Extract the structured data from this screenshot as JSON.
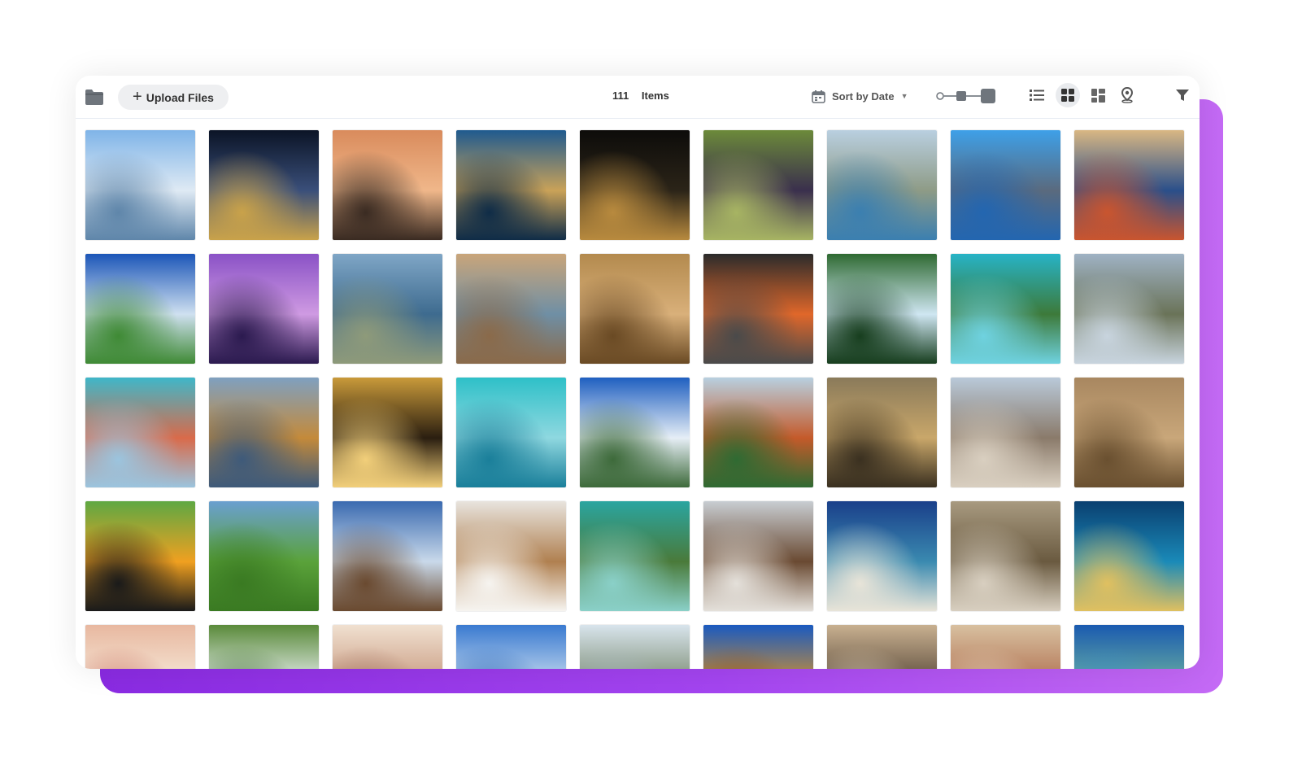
{
  "toolbar": {
    "folder_icon": "folder-icon",
    "upload_label": "Upload Files",
    "item_count": "111",
    "items_label": "Items",
    "sort_label": "Sort by Date",
    "view_modes": [
      "list-view-icon",
      "grid-view-icon",
      "mosaic-view-icon",
      "map-view-icon"
    ],
    "active_view": "grid-view-icon",
    "filter_icon": "filter-icon"
  },
  "colors": {
    "accent": "#a445f0",
    "accent_dark": "#8a2be2",
    "toolbar_button_bg": "#eeeff1",
    "text": "#333333"
  },
  "tiles": [
    {
      "subject": "glacier",
      "colors": [
        "#7fb4e8",
        "#dfeaf4",
        "#5f86aa"
      ]
    },
    {
      "subject": "city-lights-night",
      "colors": [
        "#0b1426",
        "#3a4f7a",
        "#c9a24a"
      ]
    },
    {
      "subject": "elephant-sunset",
      "colors": [
        "#d98b5c",
        "#f0b78a",
        "#3a2b22"
      ]
    },
    {
      "subject": "temple-reflection",
      "colors": [
        "#1f5a8f",
        "#caa258",
        "#0f2c47"
      ]
    },
    {
      "subject": "skyline-night",
      "colors": [
        "#0d0c0a",
        "#2b2418",
        "#b88a3e"
      ]
    },
    {
      "subject": "vineyard-grapes",
      "colors": [
        "#6c8a3a",
        "#3a2f4d",
        "#a7b463"
      ]
    },
    {
      "subject": "coastal-city",
      "colors": [
        "#b9cfe0",
        "#8e9b86",
        "#3b7fb0"
      ]
    },
    {
      "subject": "river-bridge",
      "colors": [
        "#3ea0e8",
        "#5a6a7e",
        "#2366b0"
      ]
    },
    {
      "subject": "rice-dish",
      "colors": [
        "#d9b783",
        "#2a4f8a",
        "#c9552f"
      ]
    },
    {
      "subject": "blue-cathedral",
      "colors": [
        "#1c56b8",
        "#cfe0f0",
        "#3f8a35"
      ]
    },
    {
      "subject": "pagoda-purple-sky",
      "colors": [
        "#8a52c6",
        "#cf9ae2",
        "#2b1a4f"
      ]
    },
    {
      "subject": "mountain-lake",
      "colors": [
        "#7fa6c6",
        "#3e6b8f",
        "#8e9a7a"
      ]
    },
    {
      "subject": "rock-arch-coast",
      "colors": [
        "#c9a57a",
        "#6f8fa5",
        "#8a6a4a"
      ]
    },
    {
      "subject": "lion",
      "colors": [
        "#b38a4e",
        "#d9b07a",
        "#6a4a24"
      ]
    },
    {
      "subject": "lava-flow",
      "colors": [
        "#2b2b2b",
        "#e0672a",
        "#4a4a4a"
      ]
    },
    {
      "subject": "waterfall",
      "colors": [
        "#2f6a32",
        "#cfe6f2",
        "#173e1e"
      ]
    },
    {
      "subject": "turquoise-bay",
      "colors": [
        "#27b3c6",
        "#3d7a3a",
        "#6fd2e0"
      ]
    },
    {
      "subject": "great-wall",
      "colors": [
        "#9fb2c4",
        "#6a7358",
        "#c8d4de"
      ]
    },
    {
      "subject": "colorful-harbor",
      "colors": [
        "#3fb7c9",
        "#d96a4a",
        "#9bc4de"
      ]
    },
    {
      "subject": "cliff-lake",
      "colors": [
        "#7fa0c0",
        "#c48a3a",
        "#3e5a7a"
      ]
    },
    {
      "subject": "surfer-sunset",
      "colors": [
        "#c99a3a",
        "#2a1e10",
        "#f2cf7a"
      ]
    },
    {
      "subject": "snorkeler",
      "colors": [
        "#2ec0c8",
        "#8fd8e0",
        "#1a7f9a"
      ]
    },
    {
      "subject": "iguazu-falls",
      "colors": [
        "#1f5fc0",
        "#e6eef6",
        "#3d6a3a"
      ]
    },
    {
      "subject": "pavilion-garden",
      "colors": [
        "#b8d0e0",
        "#c45a2a",
        "#2f6a32"
      ]
    },
    {
      "subject": "jaguars",
      "colors": [
        "#8a7a5a",
        "#c9a76a",
        "#3a3020"
      ]
    },
    {
      "subject": "paris-rooftops",
      "colors": [
        "#b9c9d9",
        "#8a7a6a",
        "#d9cfc0"
      ]
    },
    {
      "subject": "terracotta-warriors",
      "colors": [
        "#a88760",
        "#c9a77a",
        "#6a5030"
      ]
    },
    {
      "subject": "toucan",
      "colors": [
        "#5ea843",
        "#f0a020",
        "#1a1a1a"
      ]
    },
    {
      "subject": "green-field",
      "colors": [
        "#6a9fd0",
        "#5aa23a",
        "#3a7a22"
      ]
    },
    {
      "subject": "baobab-tree",
      "colors": [
        "#3a6ab0",
        "#c9d9ea",
        "#6a4a30"
      ]
    },
    {
      "subject": "cafe-chairs",
      "colors": [
        "#e8e4de",
        "#b08050",
        "#f6f4f0"
      ]
    },
    {
      "subject": "yacht-bay",
      "colors": [
        "#2aa5a0",
        "#4a7a3a",
        "#8ad0c8"
      ]
    },
    {
      "subject": "half-timbered-houses",
      "colors": [
        "#c8cdd2",
        "#6a4a32",
        "#e4e0da"
      ]
    },
    {
      "subject": "table-mountain-beach",
      "colors": [
        "#1a3f8a",
        "#3a8ab0",
        "#e8e4d8"
      ]
    },
    {
      "subject": "forest-boardwalk",
      "colors": [
        "#a89a80",
        "#6a5a40",
        "#d8cfc0"
      ]
    },
    {
      "subject": "city-night-reflection",
      "colors": [
        "#0a3f70",
        "#1a8ab8",
        "#e0c060"
      ]
    },
    {
      "subject": "turkish-delight",
      "colors": [
        "#e8b8a0",
        "#f6e8d8",
        "#c86a5a"
      ]
    },
    {
      "subject": "green-waterfall",
      "colors": [
        "#5a8a3a",
        "#e8f0f0",
        "#3a6a2a"
      ]
    },
    {
      "subject": "mosque-dome",
      "colors": [
        "#f0e0d0",
        "#c89a80",
        "#a07060"
      ]
    },
    {
      "subject": "blue-sea-horizon",
      "colors": [
        "#3a7ad0",
        "#c8dcf0",
        "#1a5ab0"
      ]
    },
    {
      "subject": "misty-mountains",
      "colors": [
        "#d8e4ec",
        "#7a8a70",
        "#a8b8c0"
      ]
    },
    {
      "subject": "golden-dome",
      "colors": [
        "#1a5ac0",
        "#d09030",
        "#8a5020"
      ]
    },
    {
      "subject": "arched-courtyard",
      "colors": [
        "#c8b090",
        "#5a4a3a",
        "#e0d0b8"
      ]
    },
    {
      "subject": "brick-building",
      "colors": [
        "#d8c0a0",
        "#b07050",
        "#e8d8c0"
      ]
    },
    {
      "subject": "statue-of-liberty",
      "colors": [
        "#1a5ab0",
        "#6ab0a0",
        "#3a8ac8"
      ]
    }
  ]
}
